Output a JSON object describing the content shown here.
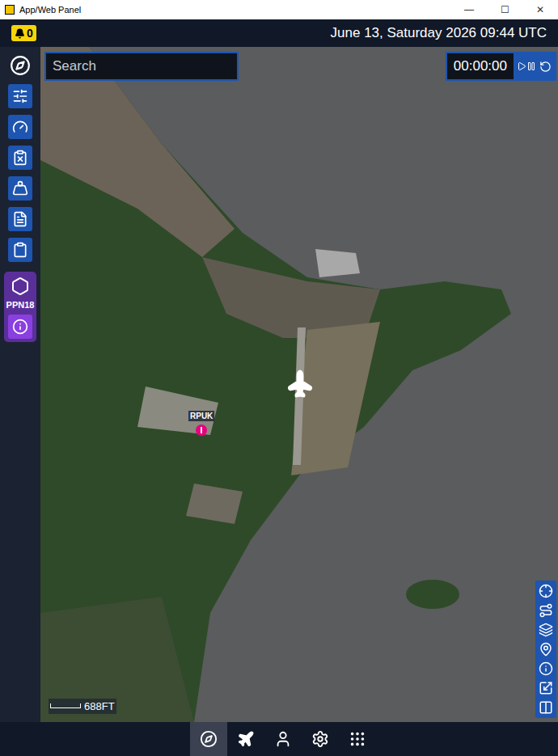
{
  "window": {
    "title": "App/Web Panel",
    "controls": [
      "—",
      "☐",
      "✕"
    ]
  },
  "header": {
    "notifications": "0",
    "datetime": "June 13, Saturday 2026 09:44 UTC"
  },
  "search": {
    "placeholder": "Search"
  },
  "timer": {
    "time": "00:00:00",
    "playing": false
  },
  "sidebar": {
    "items": [
      {
        "kind": "home"
      },
      {
        "kind": "tool"
      },
      {
        "kind": "tool"
      },
      {
        "kind": "tool"
      },
      {
        "kind": "tool"
      },
      {
        "kind": "tool"
      },
      {
        "kind": "tool"
      }
    ],
    "plugin": {
      "label": "PPN18"
    }
  },
  "map": {
    "airport": {
      "label": "RPUK"
    },
    "scale": "688FT"
  },
  "bottom_nav": {
    "items": [
      {
        "selected": true
      },
      {
        "selected": false
      },
      {
        "selected": false
      },
      {
        "selected": false
      },
      {
        "selected": false
      }
    ]
  }
}
